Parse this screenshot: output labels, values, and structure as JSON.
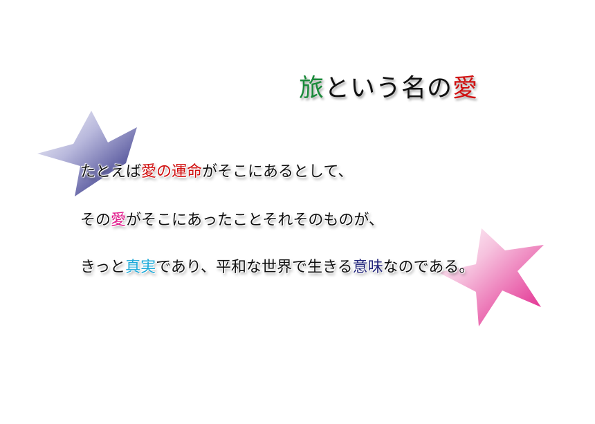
{
  "title": {
    "part1": "旅",
    "part2": "という名の",
    "part3": "愛"
  },
  "lines": [
    {
      "segments": [
        {
          "text": "たとえば",
          "color": "#111111"
        },
        {
          "text": "愛の運命",
          "color": "#d01010"
        },
        {
          "text": "がそこにあるとして、",
          "color": "#111111"
        }
      ]
    },
    {
      "segments": [
        {
          "text": "その",
          "color": "#111111"
        },
        {
          "text": "愛",
          "color": "#e0188a"
        },
        {
          "text": "がそこにあったことそれそのものが、",
          "color": "#111111"
        }
      ]
    },
    {
      "segments": [
        {
          "text": "きっと",
          "color": "#111111"
        },
        {
          "text": "真実",
          "color": "#1aa8d8"
        },
        {
          "text": "であり、平和な世界で生きる",
          "color": "#111111"
        },
        {
          "text": "意味",
          "color": "#22247a"
        },
        {
          "text": "なのである。",
          "color": "#111111"
        }
      ]
    }
  ],
  "colors": {
    "title_green": "#1a8a3a",
    "title_red": "#d01010",
    "star_left": "#2a2a80",
    "star_right": "#e0208a"
  }
}
